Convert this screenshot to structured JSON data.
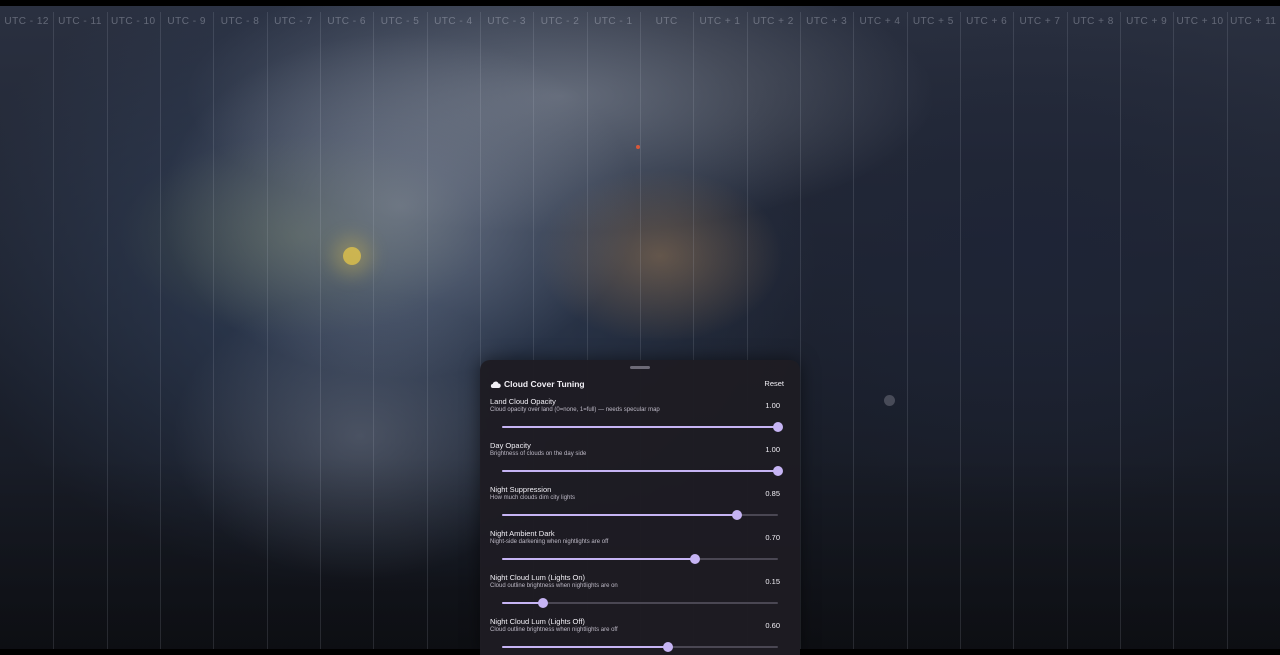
{
  "map": {
    "timezones": [
      "UTC - 12",
      "UTC - 11",
      "UTC - 10",
      "UTC - 9",
      "UTC - 8",
      "UTC - 7",
      "UTC - 6",
      "UTC - 5",
      "UTC - 4",
      "UTC - 3",
      "UTC - 2",
      "UTC - 1",
      "UTC",
      "UTC + 1",
      "UTC + 2",
      "UTC + 3",
      "UTC + 4",
      "UTC + 5",
      "UTC + 6",
      "UTC + 7",
      "UTC + 8",
      "UTC + 9",
      "UTC + 10",
      "UTC + 11"
    ]
  },
  "panel": {
    "icon": "cloud-icon",
    "title": "Cloud Cover Tuning",
    "reset_label": "Reset",
    "accent_color": "#c6b4f4",
    "settings": [
      {
        "label": "Land Cloud Opacity",
        "description": "Cloud opacity over land (0=none, 1=full) — needs specular map",
        "value_text": "1.00",
        "value": 1.0,
        "min": 0,
        "max": 1
      },
      {
        "label": "Day Opacity",
        "description": "Brightness of clouds on the day side",
        "value_text": "1.00",
        "value": 1.0,
        "min": 0,
        "max": 1
      },
      {
        "label": "Night Suppression",
        "description": "How much clouds dim city lights",
        "value_text": "0.85",
        "value": 0.85,
        "min": 0,
        "max": 1
      },
      {
        "label": "Night Ambient Dark",
        "description": "Night-side darkening when nightlights are off",
        "value_text": "0.70",
        "value": 0.7,
        "min": 0,
        "max": 1
      },
      {
        "label": "Night Cloud Lum (Lights On)",
        "description": "Cloud outline brightness when nightlights are on",
        "value_text": "0.15",
        "value": 0.15,
        "min": 0,
        "max": 1
      },
      {
        "label": "Night Cloud Lum (Lights Off)",
        "description": "Cloud outline brightness when nightlights are off",
        "value_text": "0.60",
        "value": 0.6,
        "min": 0,
        "max": 1
      }
    ]
  }
}
